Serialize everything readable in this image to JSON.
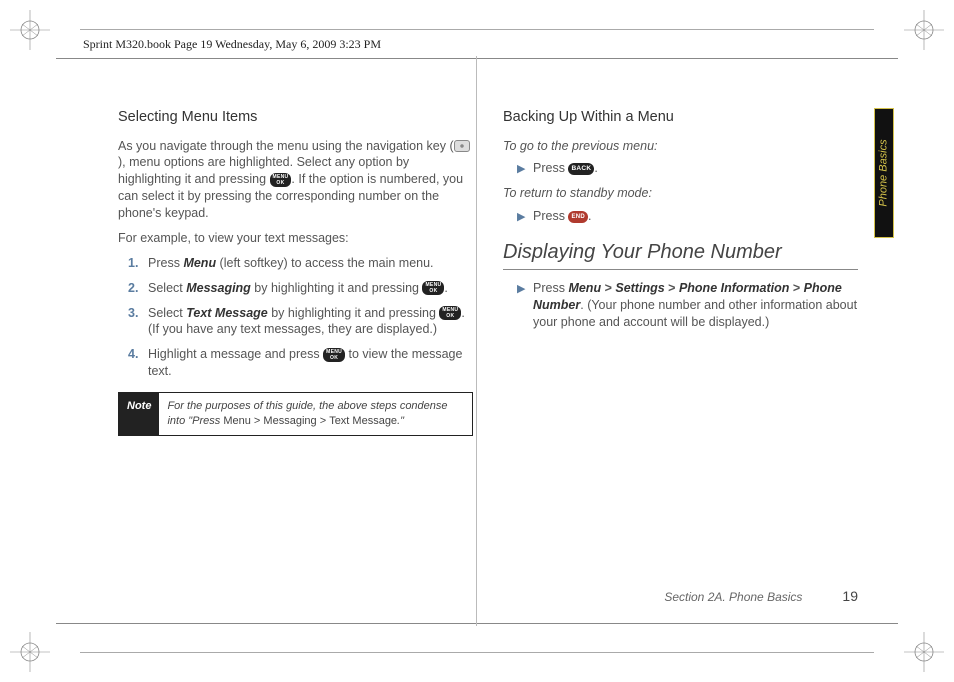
{
  "running_header": "Sprint M320.book  Page 19  Wednesday, May 6, 2009  3:23 PM",
  "side_tab": "Phone Basics",
  "left": {
    "heading": "Selecting Menu Items",
    "intro_a": "As you navigate through the menu using the navigation key (",
    "intro_b": "), menu options are highlighted. Select any option by highlighting it and pressing ",
    "intro_c": ". If the option is numbered, you can select it by pressing the corresponding number on the phone's keypad.",
    "example_lead": "For example, to view your text messages:",
    "steps": [
      {
        "num": "1.",
        "a": "Press ",
        "term": "Menu",
        "b": " (left softkey) to access the main menu."
      },
      {
        "num": "2.",
        "a": "Select ",
        "term": "Messaging",
        "b": " by highlighting it and pressing ",
        "c": "."
      },
      {
        "num": "3.",
        "a": "Select ",
        "term": "Text Message",
        "b": " by highlighting it and pressing ",
        "c": ". (If you have any text messages, they are displayed.)"
      },
      {
        "num": "4.",
        "a": "Highlight a message and press ",
        "b": " to view the message text."
      }
    ],
    "note_label": "Note",
    "note_a": "For the purposes of this guide, the above steps condense into \"Press ",
    "note_path1": "Menu",
    "note_gt": ">",
    "note_path2": "Messaging",
    "note_path3": "Text Message",
    "note_close": ".\""
  },
  "right": {
    "heading": "Backing Up Within a Menu",
    "prev_lead": "To go to the previous menu:",
    "press": "Press ",
    "period": ".",
    "standby_lead": "To return to standby mode:",
    "section_title": "Displaying Your Phone Number",
    "path_press": "Press ",
    "path1": "Menu",
    "path2": "Settings",
    "path3": "Phone Information",
    "path4": "Phone Number",
    "gt": ">",
    "path_tail": " (Your phone number and other information about your phone and account will be displayed.)"
  },
  "footer": {
    "section": "Section 2A. Phone Basics",
    "page": "19"
  }
}
